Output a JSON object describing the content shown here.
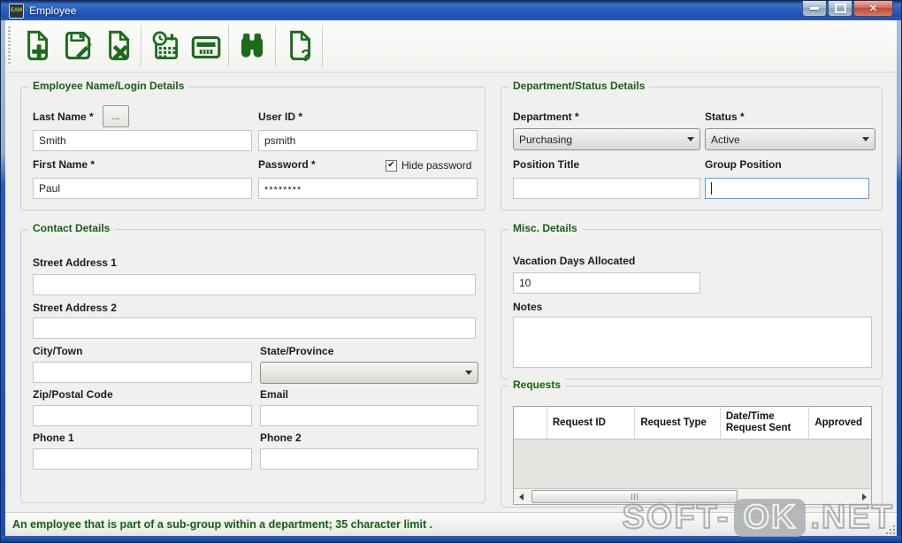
{
  "titlebar": {
    "title": "Employee",
    "app_icon_text": "EAM",
    "buttons": [
      {
        "icon": "minimize-icon"
      },
      {
        "icon": "maximize-icon"
      },
      {
        "icon": "close-icon"
      }
    ]
  },
  "toolbar": {
    "buttons": [
      {
        "icon": "new-record-icon"
      },
      {
        "icon": "save-record-icon"
      },
      {
        "icon": "cancel-record-icon"
      },
      {
        "icon": "calendar-clock-icon"
      },
      {
        "icon": "card-view-icon"
      },
      {
        "icon": "binoculars-search-icon"
      },
      {
        "icon": "help-document-icon"
      }
    ]
  },
  "groups": {
    "name_login": {
      "title": "Employee Name/Login Details",
      "last_name": {
        "label": "Last Name *",
        "value": "Smith",
        "browse_label": "..."
      },
      "user_id": {
        "label": "User ID *",
        "value": "psmith"
      },
      "first_name": {
        "label": "First Name *",
        "value": "Paul"
      },
      "password": {
        "label": "Password *",
        "value": "********",
        "hide_label": "Hide password",
        "hide_checked": true
      }
    },
    "dept_status": {
      "title": "Department/Status Details",
      "department": {
        "label": "Department *",
        "value": "Purchasing"
      },
      "status": {
        "label": "Status *",
        "value": "Active"
      },
      "position_title": {
        "label": "Position Title",
        "value": ""
      },
      "group_position": {
        "label": "Group Position",
        "value": ""
      }
    },
    "contact": {
      "title": "Contact Details",
      "street1": {
        "label": "Street Address 1",
        "value": ""
      },
      "street2": {
        "label": "Street Address 2",
        "value": ""
      },
      "city": {
        "label": "City/Town",
        "value": ""
      },
      "state": {
        "label": "State/Province",
        "value": ""
      },
      "zip": {
        "label": "Zip/Postal Code",
        "value": ""
      },
      "email": {
        "label": "Email",
        "value": ""
      },
      "phone1": {
        "label": "Phone 1",
        "value": ""
      },
      "phone2": {
        "label": "Phone 2",
        "value": ""
      }
    },
    "misc": {
      "title": "Misc. Details",
      "vacation": {
        "label": "Vacation Days Allocated",
        "value": "10"
      },
      "notes": {
        "label": "Notes",
        "value": ""
      }
    },
    "requests": {
      "title": "Requests",
      "columns": [
        "",
        "Request ID",
        "Request Type",
        "Date/Time Request Sent",
        "Approved"
      ],
      "rows": []
    }
  },
  "status_bar": {
    "text": "An employee that is part of a sub-group within a department; 35 character limit ."
  },
  "watermark": {
    "part1": "SOFT-",
    "part2": "OK",
    "part3": ".NET"
  },
  "colors": {
    "icon_green": "#1c6b1c",
    "group_title_green": "#176117",
    "status_text_green": "#156015",
    "titlebar_blue": "#2a5fc0",
    "close_button_red": "#c04a3a"
  }
}
